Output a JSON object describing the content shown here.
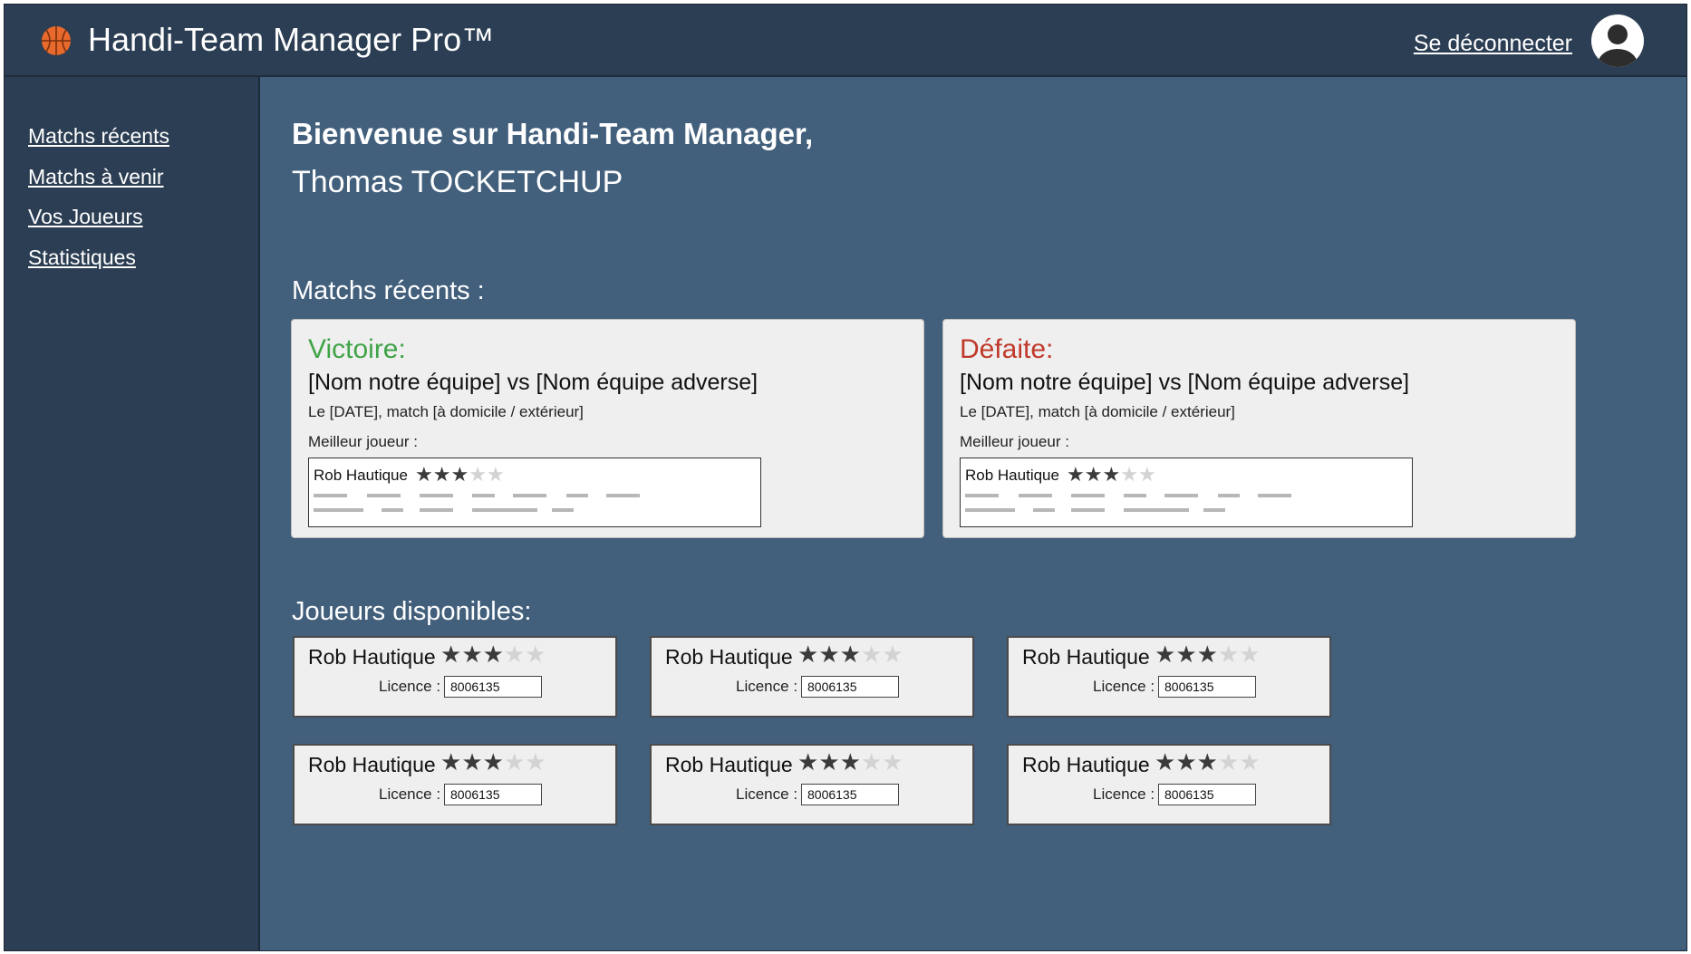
{
  "header": {
    "logo_icon": "basketball-icon",
    "app_title": "Handi-Team Manager Pro™",
    "logout_label": "Se déconnecter",
    "avatar_icon": "user-avatar-icon"
  },
  "sidebar": {
    "items": [
      {
        "label": "Matchs récents"
      },
      {
        "label": "Matchs à venir"
      },
      {
        "label": "Vos Joueurs"
      },
      {
        "label": "Statistiques"
      }
    ]
  },
  "main": {
    "welcome_line1": "Bienvenue sur Handi-Team Manager,",
    "welcome_line2": "Thomas TOCKETCHUP",
    "recent_title": "Matchs récents :",
    "players_title": "Joueurs disponibles:",
    "matches": [
      {
        "result": "Victoire:",
        "result_color": "#3fa447",
        "teams": "[Nom notre équipe] vs [Nom équipe adverse]",
        "meta": "Le [DATE], match [à domicile / extérieur]",
        "best_label": "Meilleur joueur :",
        "best_player": {
          "name": "Rob Hautique",
          "rating": 3,
          "max_rating": 5
        }
      },
      {
        "result": "Défaite:",
        "result_color": "#c0392b",
        "teams": "[Nom notre équipe] vs [Nom équipe adverse]",
        "meta": "Le [DATE], match [à domicile / extérieur]",
        "best_label": "Meilleur joueur :",
        "best_player": {
          "name": "Rob Hautique",
          "rating": 3,
          "max_rating": 5
        }
      }
    ],
    "players": [
      {
        "name": "Rob Hautique",
        "rating": 3,
        "max_rating": 5,
        "licence_label": "Licence :",
        "licence": "8006135"
      },
      {
        "name": "Rob Hautique",
        "rating": 3,
        "max_rating": 5,
        "licence_label": "Licence :",
        "licence": "8006135"
      },
      {
        "name": "Rob Hautique",
        "rating": 3,
        "max_rating": 5,
        "licence_label": "Licence :",
        "licence": "8006135"
      },
      {
        "name": "Rob Hautique",
        "rating": 3,
        "max_rating": 5,
        "licence_label": "Licence :",
        "licence": "8006135"
      },
      {
        "name": "Rob Hautique",
        "rating": 3,
        "max_rating": 5,
        "licence_label": "Licence :",
        "licence": "8006135"
      },
      {
        "name": "Rob Hautique",
        "rating": 3,
        "max_rating": 5,
        "licence_label": "Licence :",
        "licence": "8006135"
      }
    ]
  },
  "colors": {
    "header_bg": "#2c3e53",
    "main_bg": "#425f7c",
    "card_bg": "#efefef",
    "star_filled": "#3b3b3b",
    "star_empty": "#d3d3d3"
  }
}
